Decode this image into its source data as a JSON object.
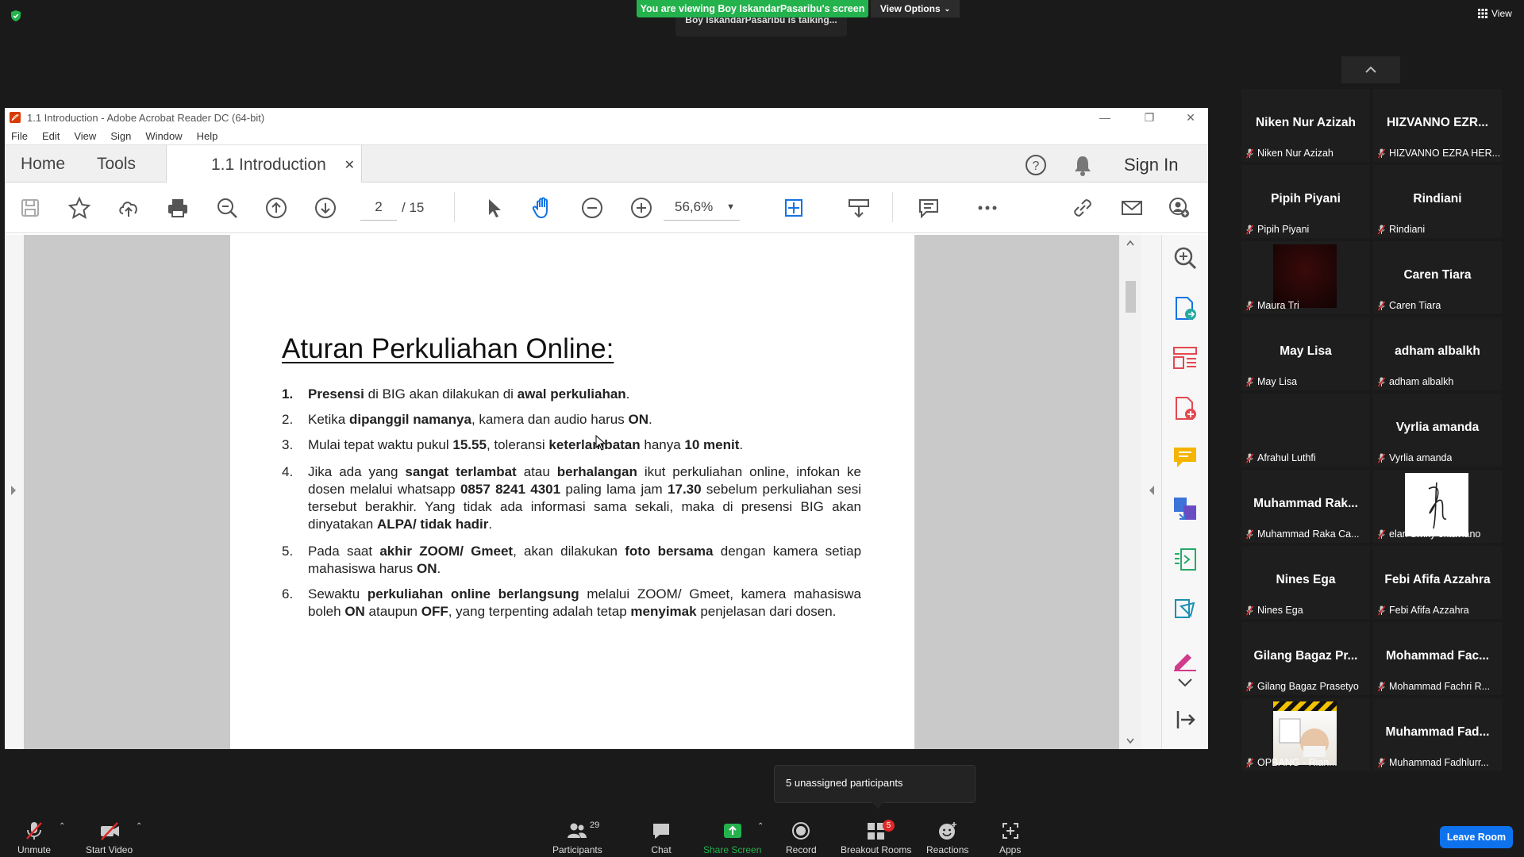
{
  "zoom_meeting": {
    "banner": "You are viewing Boy IskandarPasaribu's screen",
    "view_options": "View Options",
    "talking": "Boy IskandarPasaribu is talking...",
    "view_label": "View"
  },
  "acrobat": {
    "window_title": "1.1  Introduction - Adobe Acrobat Reader DC (64-bit)",
    "menu": [
      "File",
      "Edit",
      "View",
      "Sign",
      "Window",
      "Help"
    ],
    "tabs": {
      "home": "Home",
      "tools": "Tools",
      "doc": "1.1  Introduction"
    },
    "sign_in": "Sign In",
    "page_current": "2",
    "page_total": "/  15",
    "zoom": "56,6%",
    "document": {
      "title": "Aturan Perkuliahan Online:",
      "items": [
        {
          "num": "1.",
          "html": "<b>Presensi</b> di BIG akan dilakukan di <b>awal perkuliahan</b>."
        },
        {
          "num": "2.",
          "html": "Ketika <b>dipanggil namanya</b>, kamera dan audio harus <b>ON</b>."
        },
        {
          "num": "3.",
          "html": "Mulai tepat waktu pukul <b>15.55</b>, toleransi <b>keterlambatan</b> hanya <b>10 menit</b>."
        },
        {
          "num": "4.",
          "html": "Jika ada yang <b>sangat terlambat</b> atau <b>berhalangan</b> ikut perkuliahan online, infokan ke dosen melalui whatsapp <b>0857 8241 4301</b> paling lama jam <b>17.30</b> sebelum perkuliahan sesi tersebut berakhir. Yang tidak ada informasi sama sekali, maka di presensi BIG akan dinyatakan <b>ALPA/ tidak hadir</b>."
        },
        {
          "num": "5.",
          "html": "Pada saat <b>akhir ZOOM/ Gmeet</b>, akan dilakukan <b>foto bersama</b> dengan kamera setiap mahasiswa harus <b>ON</b>."
        },
        {
          "num": "6.",
          "html": "Sewaktu <b>perkuliahan online berlangsung</b> melalui ZOOM/ Gmeet, kamera mahasiswa boleh <b>ON</b> ataupun <b>OFF</b>, yang terpenting adalah tetap <b>menyimak</b> penjelasan dari dosen."
        }
      ]
    }
  },
  "participants": [
    {
      "name": "Niken Nur Azizah",
      "label": "Niken Nur Azizah"
    },
    {
      "name": "HIZVANNO  EZR...",
      "label": "HIZVANNO EZRA HER..."
    },
    {
      "name": "Pipih Piyani",
      "label": "Pipih Piyani"
    },
    {
      "name": "Rindiani",
      "label": "Rindiani"
    },
    {
      "name": "",
      "label": "Maura Tri",
      "video": "dark-red"
    },
    {
      "name": "Caren Tiara",
      "label": "Caren Tiara"
    },
    {
      "name": "May Lisa",
      "label": "May Lisa"
    },
    {
      "name": "adham albalkh",
      "label": "adham albalkh"
    },
    {
      "name": "",
      "label": "Afrahul Luthfi"
    },
    {
      "name": "Vyrlia amanda",
      "label": "Vyrlia amanda"
    },
    {
      "name": "Muhammad  Rak...",
      "label": "Muhammad Raka Ca..."
    },
    {
      "name": "",
      "label": "elan dwiky oktaviano",
      "video": "signature"
    },
    {
      "name": "Nines Ega",
      "label": "Nines Ega"
    },
    {
      "name": "Febi Afifa Azzahra",
      "label": "Febi Afifa Azzahra"
    },
    {
      "name": "Gilang Bagaz  Pr...",
      "label": "Gilang Bagaz Prasetyo"
    },
    {
      "name": "Mohammad  Fac...",
      "label": "Mohammad Fachri R..."
    },
    {
      "name": "",
      "label": "OPBANG - Rian...",
      "video": "construction"
    },
    {
      "name": "Muhammad  Fad...",
      "label": "Muhammad Fadhlurr..."
    }
  ],
  "toolbar": {
    "unmute": "Unmute",
    "start_video": "Start Video",
    "participants": "Participants",
    "participants_count": "29",
    "chat": "Chat",
    "share_screen": "Share Screen",
    "record": "Record",
    "breakout_rooms": "Breakout Rooms",
    "breakout_badge": "5",
    "reactions": "Reactions",
    "apps": "Apps",
    "leave": "Leave Room"
  },
  "tooltip": "5 unassigned participants",
  "colors": {
    "share_green": "#24b24d",
    "leave_blue": "#0e72ed",
    "mic_red": "#e02828"
  }
}
